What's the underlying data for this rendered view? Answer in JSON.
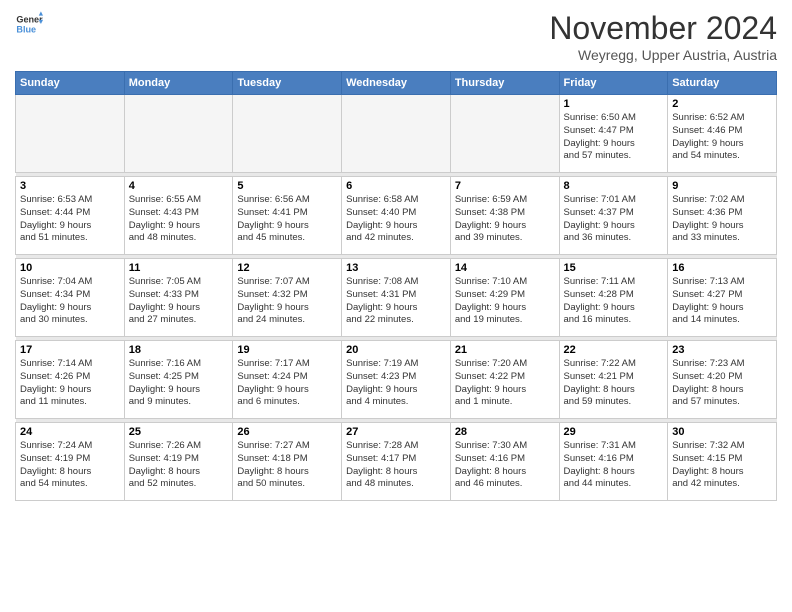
{
  "logo": {
    "line1": "General",
    "line2": "Blue"
  },
  "title": "November 2024",
  "location": "Weyregg, Upper Austria, Austria",
  "headers": [
    "Sunday",
    "Monday",
    "Tuesday",
    "Wednesday",
    "Thursday",
    "Friday",
    "Saturday"
  ],
  "weeks": [
    [
      {
        "day": "",
        "info": ""
      },
      {
        "day": "",
        "info": ""
      },
      {
        "day": "",
        "info": ""
      },
      {
        "day": "",
        "info": ""
      },
      {
        "day": "",
        "info": ""
      },
      {
        "day": "1",
        "info": "Sunrise: 6:50 AM\nSunset: 4:47 PM\nDaylight: 9 hours\nand 57 minutes."
      },
      {
        "day": "2",
        "info": "Sunrise: 6:52 AM\nSunset: 4:46 PM\nDaylight: 9 hours\nand 54 minutes."
      }
    ],
    [
      {
        "day": "3",
        "info": "Sunrise: 6:53 AM\nSunset: 4:44 PM\nDaylight: 9 hours\nand 51 minutes."
      },
      {
        "day": "4",
        "info": "Sunrise: 6:55 AM\nSunset: 4:43 PM\nDaylight: 9 hours\nand 48 minutes."
      },
      {
        "day": "5",
        "info": "Sunrise: 6:56 AM\nSunset: 4:41 PM\nDaylight: 9 hours\nand 45 minutes."
      },
      {
        "day": "6",
        "info": "Sunrise: 6:58 AM\nSunset: 4:40 PM\nDaylight: 9 hours\nand 42 minutes."
      },
      {
        "day": "7",
        "info": "Sunrise: 6:59 AM\nSunset: 4:38 PM\nDaylight: 9 hours\nand 39 minutes."
      },
      {
        "day": "8",
        "info": "Sunrise: 7:01 AM\nSunset: 4:37 PM\nDaylight: 9 hours\nand 36 minutes."
      },
      {
        "day": "9",
        "info": "Sunrise: 7:02 AM\nSunset: 4:36 PM\nDaylight: 9 hours\nand 33 minutes."
      }
    ],
    [
      {
        "day": "10",
        "info": "Sunrise: 7:04 AM\nSunset: 4:34 PM\nDaylight: 9 hours\nand 30 minutes."
      },
      {
        "day": "11",
        "info": "Sunrise: 7:05 AM\nSunset: 4:33 PM\nDaylight: 9 hours\nand 27 minutes."
      },
      {
        "day": "12",
        "info": "Sunrise: 7:07 AM\nSunset: 4:32 PM\nDaylight: 9 hours\nand 24 minutes."
      },
      {
        "day": "13",
        "info": "Sunrise: 7:08 AM\nSunset: 4:31 PM\nDaylight: 9 hours\nand 22 minutes."
      },
      {
        "day": "14",
        "info": "Sunrise: 7:10 AM\nSunset: 4:29 PM\nDaylight: 9 hours\nand 19 minutes."
      },
      {
        "day": "15",
        "info": "Sunrise: 7:11 AM\nSunset: 4:28 PM\nDaylight: 9 hours\nand 16 minutes."
      },
      {
        "day": "16",
        "info": "Sunrise: 7:13 AM\nSunset: 4:27 PM\nDaylight: 9 hours\nand 14 minutes."
      }
    ],
    [
      {
        "day": "17",
        "info": "Sunrise: 7:14 AM\nSunset: 4:26 PM\nDaylight: 9 hours\nand 11 minutes."
      },
      {
        "day": "18",
        "info": "Sunrise: 7:16 AM\nSunset: 4:25 PM\nDaylight: 9 hours\nand 9 minutes."
      },
      {
        "day": "19",
        "info": "Sunrise: 7:17 AM\nSunset: 4:24 PM\nDaylight: 9 hours\nand 6 minutes."
      },
      {
        "day": "20",
        "info": "Sunrise: 7:19 AM\nSunset: 4:23 PM\nDaylight: 9 hours\nand 4 minutes."
      },
      {
        "day": "21",
        "info": "Sunrise: 7:20 AM\nSunset: 4:22 PM\nDaylight: 9 hours\nand 1 minute."
      },
      {
        "day": "22",
        "info": "Sunrise: 7:22 AM\nSunset: 4:21 PM\nDaylight: 8 hours\nand 59 minutes."
      },
      {
        "day": "23",
        "info": "Sunrise: 7:23 AM\nSunset: 4:20 PM\nDaylight: 8 hours\nand 57 minutes."
      }
    ],
    [
      {
        "day": "24",
        "info": "Sunrise: 7:24 AM\nSunset: 4:19 PM\nDaylight: 8 hours\nand 54 minutes."
      },
      {
        "day": "25",
        "info": "Sunrise: 7:26 AM\nSunset: 4:19 PM\nDaylight: 8 hours\nand 52 minutes."
      },
      {
        "day": "26",
        "info": "Sunrise: 7:27 AM\nSunset: 4:18 PM\nDaylight: 8 hours\nand 50 minutes."
      },
      {
        "day": "27",
        "info": "Sunrise: 7:28 AM\nSunset: 4:17 PM\nDaylight: 8 hours\nand 48 minutes."
      },
      {
        "day": "28",
        "info": "Sunrise: 7:30 AM\nSunset: 4:16 PM\nDaylight: 8 hours\nand 46 minutes."
      },
      {
        "day": "29",
        "info": "Sunrise: 7:31 AM\nSunset: 4:16 PM\nDaylight: 8 hours\nand 44 minutes."
      },
      {
        "day": "30",
        "info": "Sunrise: 7:32 AM\nSunset: 4:15 PM\nDaylight: 8 hours\nand 42 minutes."
      }
    ]
  ]
}
